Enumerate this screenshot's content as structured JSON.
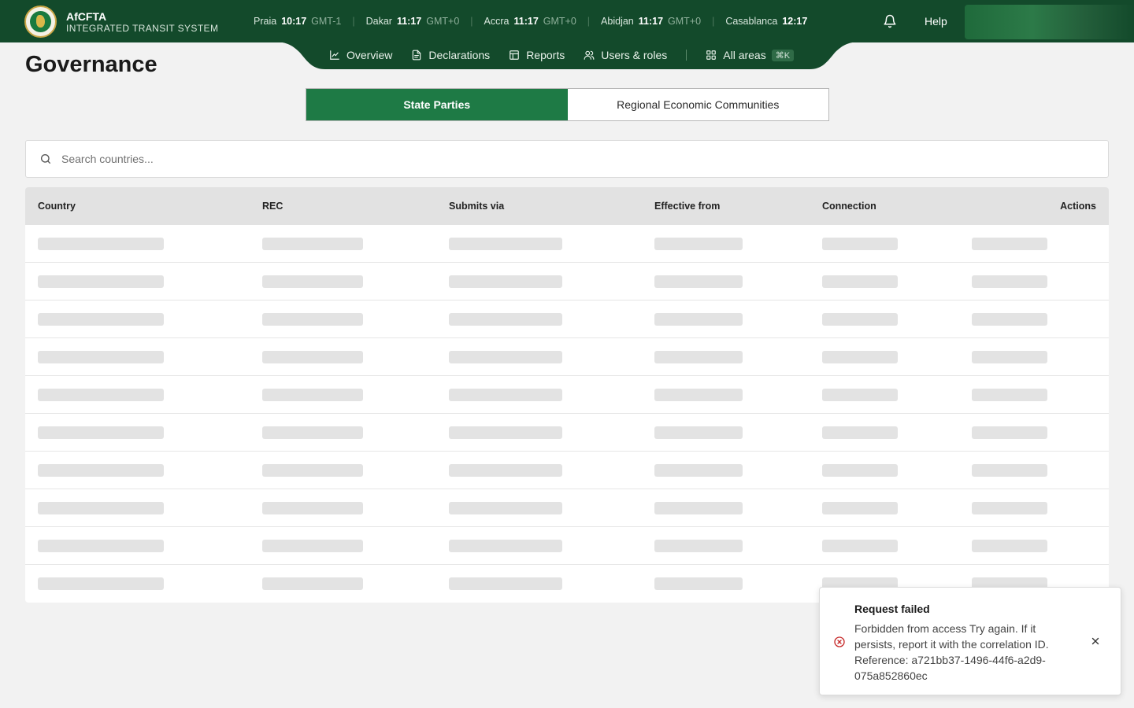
{
  "brand": {
    "name": "AfCFTA",
    "subtitle": "INTEGRATED TRANSIT SYSTEM"
  },
  "clocks": [
    {
      "city": "Praia",
      "time": "10:17",
      "tz": "GMT-1"
    },
    {
      "city": "Dakar",
      "time": "11:17",
      "tz": "GMT+0"
    },
    {
      "city": "Accra",
      "time": "11:17",
      "tz": "GMT+0"
    },
    {
      "city": "Abidjan",
      "time": "11:17",
      "tz": "GMT+0"
    },
    {
      "city": "Casablanca",
      "time": "12:17",
      "tz": ""
    }
  ],
  "header": {
    "help_label": "Help"
  },
  "nav": {
    "overview": "Overview",
    "declarations": "Declarations",
    "reports": "Reports",
    "users_roles": "Users & roles",
    "all_areas": "All areas",
    "shortcut": "⌘K"
  },
  "page": {
    "title": "Governance"
  },
  "tabs": {
    "state_parties": "State Parties",
    "recs": "Regional Economic Communities"
  },
  "search": {
    "placeholder": "Search countries..."
  },
  "table": {
    "columns": {
      "country": "Country",
      "rec": "REC",
      "submits_via": "Submits via",
      "effective_from": "Effective from",
      "connection": "Connection",
      "actions": "Actions"
    }
  },
  "toast": {
    "title": "Request failed",
    "message": "Forbidden from access Try again. If it persists, report it with the correlation ID. Reference: a721bb37-1496-44f6-a2d9-075a852860ec"
  },
  "colors": {
    "header_bg": "#134a2b",
    "accent_green": "#1e7a45",
    "error_red": "#c62828"
  }
}
